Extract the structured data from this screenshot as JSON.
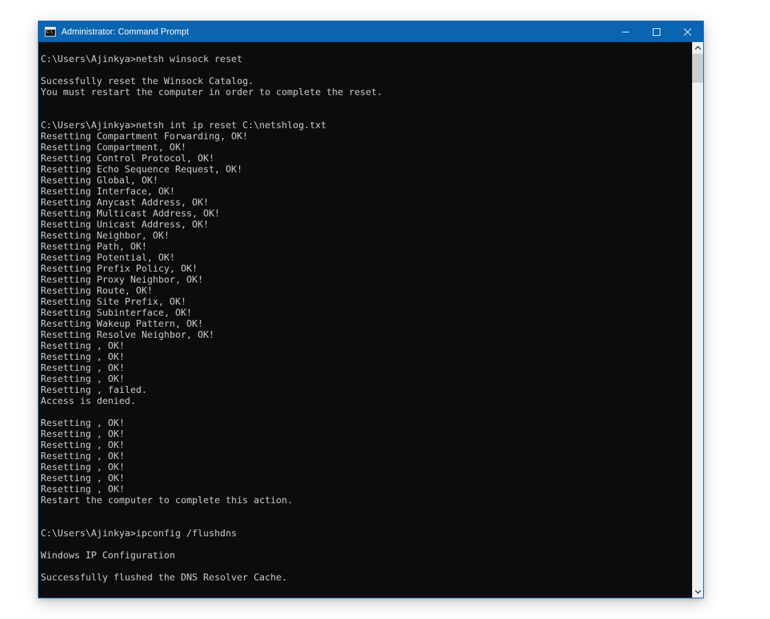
{
  "window": {
    "title": "Administrator: Command Prompt",
    "icon": "cmd-console-icon",
    "icon_glyph": "C:\\_",
    "colors": {
      "titlebar": "#0a64b0",
      "console_bg": "#0c0c0c",
      "console_fg": "#cccccc",
      "border": "#0a64b0",
      "scrollbar_track": "#f0f0f0",
      "scrollbar_thumb": "#cdcdcd"
    },
    "controls": {
      "minimize_label": "Minimize",
      "maximize_label": "Maximize",
      "close_label": "Close"
    }
  },
  "scrollbar": {
    "up_label": "Scroll up",
    "down_label": "Scroll down",
    "thumb_label": "Scroll thumb"
  },
  "console": {
    "prompt": "C:\\Users\\Ajinkya>",
    "lines": [
      "C:\\Users\\Ajinkya>netsh winsock reset",
      "",
      "Sucessfully reset the Winsock Catalog.",
      "You must restart the computer in order to complete the reset.",
      "",
      "",
      "C:\\Users\\Ajinkya>netsh int ip reset C:\\netshlog.txt",
      "Resetting Compartment Forwarding, OK!",
      "Resetting Compartment, OK!",
      "Resetting Control Protocol, OK!",
      "Resetting Echo Sequence Request, OK!",
      "Resetting Global, OK!",
      "Resetting Interface, OK!",
      "Resetting Anycast Address, OK!",
      "Resetting Multicast Address, OK!",
      "Resetting Unicast Address, OK!",
      "Resetting Neighbor, OK!",
      "Resetting Path, OK!",
      "Resetting Potential, OK!",
      "Resetting Prefix Policy, OK!",
      "Resetting Proxy Neighbor, OK!",
      "Resetting Route, OK!",
      "Resetting Site Prefix, OK!",
      "Resetting Subinterface, OK!",
      "Resetting Wakeup Pattern, OK!",
      "Resetting Resolve Neighbor, OK!",
      "Resetting , OK!",
      "Resetting , OK!",
      "Resetting , OK!",
      "Resetting , OK!",
      "Resetting , failed.",
      "Access is denied.",
      "",
      "Resetting , OK!",
      "Resetting , OK!",
      "Resetting , OK!",
      "Resetting , OK!",
      "Resetting , OK!",
      "Resetting , OK!",
      "Resetting , OK!",
      "Restart the computer to complete this action.",
      "",
      "",
      "C:\\Users\\Ajinkya>ipconfig /flushdns",
      "",
      "Windows IP Configuration",
      "",
      "Successfully flushed the DNS Resolver Cache.",
      ""
    ]
  }
}
